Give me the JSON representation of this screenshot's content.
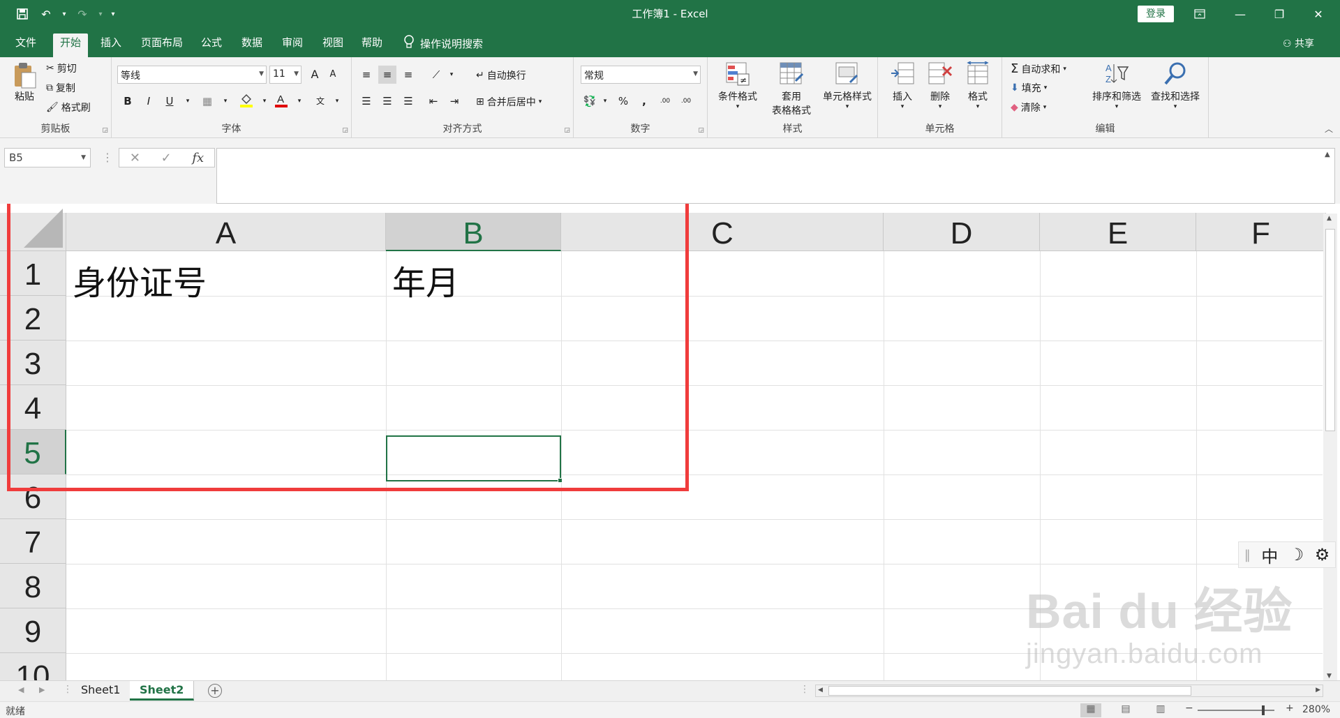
{
  "window": {
    "title": "工作簿1  -  Excel",
    "login": "登录"
  },
  "tabs": [
    "文件",
    "开始",
    "插入",
    "页面布局",
    "公式",
    "数据",
    "审阅",
    "视图",
    "帮助"
  ],
  "active_tab": "开始",
  "tell_me": "操作说明搜索",
  "share": "共享",
  "ribbon": {
    "clipboard": {
      "label": "剪贴板",
      "paste": "粘贴",
      "cut": "剪切",
      "copy": "复制",
      "painter": "格式刷"
    },
    "font": {
      "label": "字体",
      "name": "等线",
      "size": "11",
      "bold": "B",
      "italic": "I",
      "underline": "U",
      "inc": "A",
      "dec": "A"
    },
    "alignment": {
      "label": "对齐方式",
      "wrap": "自动换行",
      "merge": "合并后居中"
    },
    "number": {
      "label": "数字",
      "format": "常规",
      "percent": "%",
      "comma": ",",
      "inc_dec": ".00",
      "dec_dec": ".00"
    },
    "styles": {
      "label": "样式",
      "conditional": "条件格式",
      "table1": "套用",
      "table2": "表格格式",
      "cell_styles": "单元格样式"
    },
    "cells": {
      "label": "单元格",
      "insert": "插入",
      "delete": "删除",
      "format": "格式"
    },
    "editing": {
      "label": "编辑",
      "autosum": "自动求和",
      "fill": "填充",
      "clear": "清除",
      "sort": "排序和筛选",
      "find": "查找和选择"
    }
  },
  "name_box": "B5",
  "fx": "fx",
  "columns": [
    "A",
    "B",
    "C",
    "D",
    "E",
    "F"
  ],
  "selected_column": "B",
  "rows": [
    "1",
    "2",
    "3",
    "4",
    "5",
    "6",
    "7",
    "8",
    "9",
    "10"
  ],
  "selected_row": "5",
  "cells": {
    "A1": "身份证号",
    "B1": "年月"
  },
  "ime": {
    "mode": "中"
  },
  "watermark": {
    "line1": "Bai du 经验",
    "line2": "jingyan.baidu.com"
  },
  "sheets": [
    "Sheet1",
    "Sheet2"
  ],
  "active_sheet": "Sheet2",
  "status": {
    "ready": "就绪",
    "zoom": "280%"
  },
  "colors": {
    "excel_green": "#217346",
    "highlight_red": "#f03c3c"
  }
}
